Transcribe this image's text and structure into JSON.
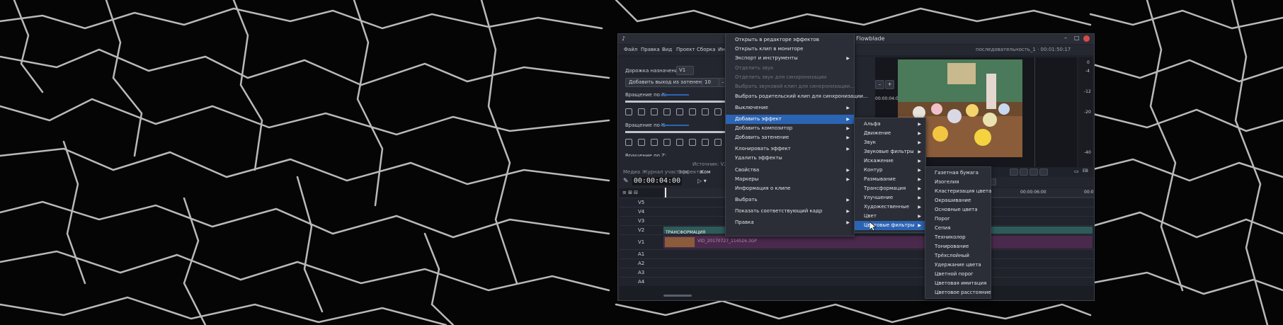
{
  "window": {
    "title": "Flowblade",
    "sequence_info": "последовательность_1 · 00:01:50:17"
  },
  "menubar": [
    "Файл",
    "Правка",
    "Вид",
    "Проект",
    "Сборка",
    "Ин"
  ],
  "left_panel": {
    "target_track_label": "Дорожка назначения:",
    "target_track_value": "V1",
    "fade_out_button": "Добавить выход из затенения",
    "fade_value": "10",
    "rotate_x_label": "Вращение по X:",
    "rotate_y_label": "Вращение по Y:",
    "rotate_z_label": "Вращение по Z:",
    "source_label": "Источник: V2 П"
  },
  "tabs": [
    "Медиа",
    "Журнал участков",
    "Эффекты",
    "Ком"
  ],
  "timecode": "00:00:04:00",
  "ruler": {
    "t1": "00:00:06:00",
    "t2": "00:0"
  },
  "monitor": {
    "timecode": "00:00:04:00"
  },
  "audio_meter": [
    "0",
    "-4",
    "-12",
    "-20",
    "-40"
  ],
  "tracks": [
    "V5",
    "V4",
    "V3",
    "V2",
    "V1",
    "A1",
    "A2",
    "A3",
    "A4"
  ],
  "clips": {
    "v2_effect_label": "ТРАНСФОРМАЦИЯ",
    "v1_clip_name": "VID_20170727_114526.3GP"
  },
  "context_menu": {
    "items": [
      {
        "label": "Открыть в редакторе эффектов",
        "enabled": true,
        "submenu": false
      },
      {
        "label": "Открыть клип в мониторе",
        "enabled": true,
        "submenu": false
      },
      {
        "label": "Экспорт и инструменты",
        "enabled": true,
        "submenu": true
      },
      {
        "label": "Отделить звук",
        "enabled": false,
        "submenu": false
      },
      {
        "label": "Отделить звук для синхронизации",
        "enabled": false,
        "submenu": false
      },
      {
        "label": "Выбрать звуковой клип для синхронизации...",
        "enabled": false,
        "submenu": false
      },
      {
        "label": "Выбрать родительский клип для синхронизации...",
        "enabled": true,
        "submenu": false
      },
      {
        "label": "Выключение",
        "enabled": true,
        "submenu": true
      },
      {
        "label": "Добавить эффект",
        "enabled": true,
        "submenu": true,
        "highlighted": true
      },
      {
        "label": "Добавить композитор",
        "enabled": true,
        "submenu": true
      },
      {
        "label": "Добавить затенение",
        "enabled": true,
        "submenu": true
      },
      {
        "label": "Клонировать эффект",
        "enabled": true,
        "submenu": true
      },
      {
        "label": "Удалить эффекты",
        "enabled": true,
        "submenu": false
      },
      {
        "label": "Свойства",
        "enabled": true,
        "submenu": true
      },
      {
        "label": "Маркеры",
        "enabled": true,
        "submenu": true
      },
      {
        "label": "Информация о клипе",
        "enabled": true,
        "submenu": false
      },
      {
        "label": "Выбрать",
        "enabled": true,
        "submenu": true
      },
      {
        "label": "Показать соответствующий кадр",
        "enabled": true,
        "submenu": true
      },
      {
        "label": "Правка",
        "enabled": true,
        "submenu": true
      }
    ]
  },
  "effect_submenu": {
    "items": [
      "Альфа",
      "Движение",
      "Звук",
      "Звуковые фильтры",
      "Искажение",
      "Контур",
      "Размывание",
      "Трансформация",
      "Улучшение",
      "Художественные",
      "Цвет",
      "Цветовые фильтры"
    ],
    "highlighted": "Цветовые фильтры"
  },
  "color_filter_submenu": {
    "items": [
      "Газетная бумага",
      "Изогелия",
      "Кластеризация цвета",
      "Окрашивание",
      "Основные цвета",
      "Порог",
      "Сепия",
      "Техниколор",
      "Тонирование",
      "Трёхслойный",
      "Удержание цвета",
      "Цветной порог",
      "Цветовая имитация",
      "Цветовое расстояние"
    ]
  },
  "colors": {
    "menu_highlight": "#2c64b4",
    "clip_v1": "#4a2a4c",
    "clip_v2": "#2e5b5a"
  }
}
